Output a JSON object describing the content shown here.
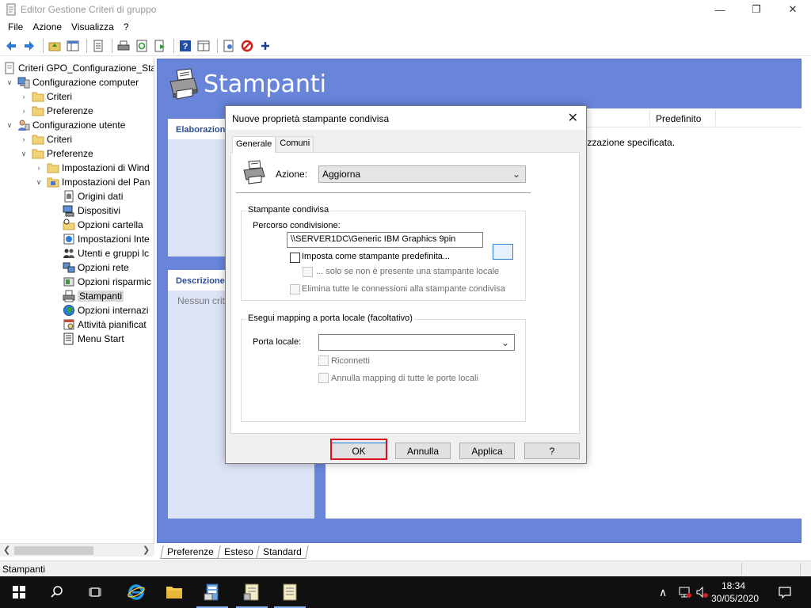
{
  "window": {
    "title": "Editor Gestione Criteri di gruppo",
    "minimize_icon": "minimize-icon",
    "maximize_icon": "restore-icon",
    "close_icon": "close-icon"
  },
  "menu": {
    "items": [
      "File",
      "Azione",
      "Visualizza",
      "?"
    ]
  },
  "toolbar": {
    "icons": [
      "back-arrow-icon",
      "forward-arrow-icon",
      "up-folder-icon",
      "show-hide-tree-icon",
      "properties-icon",
      "print-icon",
      "refresh-icon",
      "export-icon",
      "help-icon",
      "show-pane-icon",
      "details-icon",
      "stop-icon",
      "add-icon"
    ]
  },
  "tree": {
    "root": "Criteri GPO_Configurazione_Sta",
    "computer_config": "Configurazione computer",
    "computer_criteri": "Criteri",
    "computer_preferenze": "Preferenze",
    "user_config": "Configurazione utente",
    "user_criteri": "Criteri",
    "user_preferenze": "Preferenze",
    "win_settings": "Impostazioni di Wind",
    "panel_settings": "Impostazioni del Pan",
    "items": [
      "Origini dati",
      "Dispositivi",
      "Opzioni cartella",
      "Impostazioni Inte",
      "Utenti e gruppi lc",
      "Opzioni rete",
      "Opzioni risparmic",
      "Stampanti",
      "Opzioni internazi",
      "Attività pianificat",
      "Menu Start"
    ],
    "selected": "Stampanti"
  },
  "main": {
    "title": "Stampanti",
    "processing_header": "Elaborazion",
    "description_header": "Descrizione",
    "description_text": "Nessun crite",
    "column_predefinito": "Predefinito",
    "list_message": "lizzazione specificata."
  },
  "bottom_tabs": [
    "Preferenze",
    "Esteso",
    "Standard"
  ],
  "status": {
    "text": "Stampanti"
  },
  "taskbar": {
    "time": "18:34",
    "date": "30/05/2020"
  },
  "dialog": {
    "title": "Nuove proprietà stampante condivisa",
    "tabs": [
      "Generale",
      "Comuni"
    ],
    "active_tab": "Generale",
    "action_label": "Azione:",
    "action_value": "Aggiorna",
    "group_shared": "Stampante condivisa",
    "share_path_label": "Percorso condivisione:",
    "share_path_value": "\\\\SERVER1DC\\Generic IBM Graphics 9pin",
    "set_default_label": "Imposta come stampante predefinita...",
    "only_if_no_local_label": "... solo se non è presente una stampante locale",
    "delete_all_label": "Elimina tutte le connessioni alla stampante condivisa",
    "group_mapping": "Esegui mapping a porta locale (facoltativo)",
    "local_port_label": "Porta locale:",
    "local_port_value": "",
    "reconnect_label": "Riconnetti",
    "unmap_all_label": "Annulla mapping di tutte le porte locali",
    "buttons": {
      "ok": "OK",
      "cancel": "Annulla",
      "apply": "Applica",
      "help": "?"
    }
  }
}
